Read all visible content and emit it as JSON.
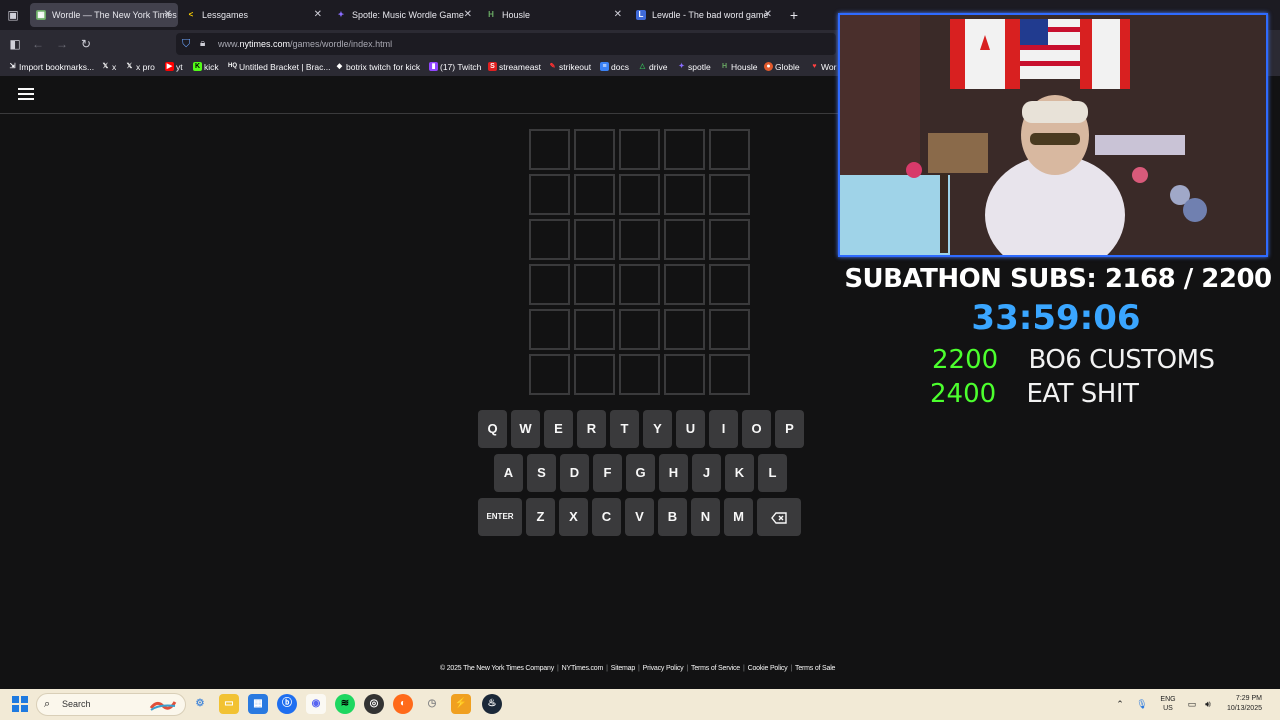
{
  "browser": {
    "tabs": [
      {
        "title": "Wordle — The New York Times",
        "favicon": "wordle-favicon",
        "active": true
      },
      {
        "title": "Lessgames",
        "favicon": "lessgames-favicon",
        "active": false
      },
      {
        "title": "Spotle: Music Wordle Game",
        "favicon": "spotle-favicon",
        "active": false
      },
      {
        "title": "Housle",
        "favicon": "housle-favicon",
        "active": false
      },
      {
        "title": "Lewdle - The bad word game",
        "favicon": "lewdle-favicon",
        "active": false
      }
    ],
    "url_prefix": "www.",
    "url_domain": "nytimes.com",
    "url_path": "/games/wordle/index.html",
    "bookmarks": [
      {
        "label": "Import bookmarks...",
        "icon": "import-icon"
      },
      {
        "label": "x",
        "icon": "x-icon"
      },
      {
        "label": "x pro",
        "icon": "x-icon"
      },
      {
        "label": "yt",
        "icon": "youtube-icon"
      },
      {
        "label": "kick",
        "icon": "kick-icon"
      },
      {
        "label": "Untitled Bracket | Brac...",
        "icon": "bracket-icon"
      },
      {
        "label": "botrix twitch for kick",
        "icon": "botrix-icon"
      },
      {
        "label": "(17) Twitch",
        "icon": "twitch-icon"
      },
      {
        "label": "streameast",
        "icon": "streameast-icon"
      },
      {
        "label": "strikeout",
        "icon": "strikeout-icon"
      },
      {
        "label": "docs",
        "icon": "docs-icon"
      },
      {
        "label": "drive",
        "icon": "drive-icon"
      },
      {
        "label": "spotle",
        "icon": "spotle-icon"
      },
      {
        "label": "Housle",
        "icon": "housle-icon"
      },
      {
        "label": "Globle",
        "icon": "globle-icon"
      },
      {
        "label": "Wor",
        "icon": "wordle-icon"
      }
    ]
  },
  "wordle": {
    "keyboard": {
      "row1": [
        "Q",
        "W",
        "E",
        "R",
        "T",
        "Y",
        "U",
        "I",
        "O",
        "P"
      ],
      "row2": [
        "A",
        "S",
        "D",
        "F",
        "G",
        "H",
        "J",
        "K",
        "L"
      ],
      "row3": [
        "ENTER",
        "Z",
        "X",
        "C",
        "V",
        "B",
        "N",
        "M"
      ],
      "backspace_icon": "backspace-icon"
    },
    "footer": [
      "© 2025 The New York Times Company",
      "NYTimes.com",
      "Sitemap",
      "Privacy Policy",
      "Terms of Service",
      "Cookie Policy",
      "Terms of Sale"
    ]
  },
  "overlay": {
    "title": "SUBATHON SUBS: 2168 / 2200",
    "timer": "33:59:06",
    "goals": [
      {
        "count": "2200",
        "label": "BO6 CUSTOMS"
      },
      {
        "count": "2400",
        "label": "EAT SHIT"
      }
    ]
  },
  "taskbar": {
    "search_placeholder": "Search",
    "lang_top": "ENG",
    "lang_bottom": "US",
    "time": "7:29 PM",
    "date": "10/13/2025"
  },
  "colors": {
    "page_bg": "#121213",
    "tile_border": "#3a3a3c",
    "key_bg": "#3a3a3c",
    "timer": "#3aa6ff",
    "goal_count": "#4cff2e",
    "cam_border": "#2f6bff"
  }
}
